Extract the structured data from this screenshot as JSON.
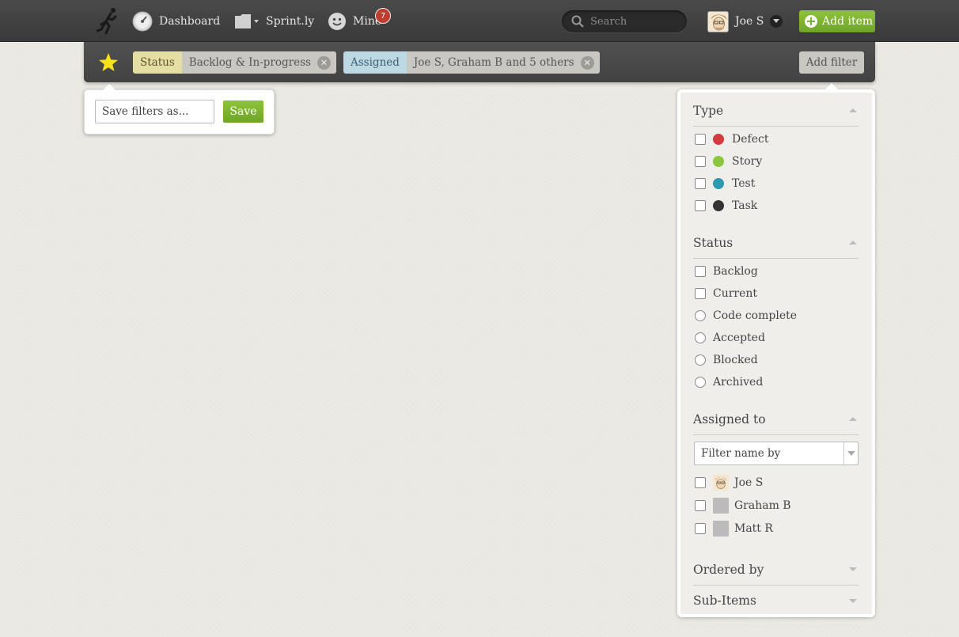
{
  "topbar": {
    "nav": {
      "dashboard": "Dashboard",
      "project": "Sprint.ly",
      "mine": "Mine",
      "mine_count": "7"
    },
    "search_placeholder": "Search",
    "user_name": "Joe S",
    "add_item": "Add item",
    "colors": {
      "bar": "#3f3f3f",
      "accent_green": "#7db433",
      "badge_red": "#c23b2f"
    }
  },
  "filters": {
    "status_label": "Status",
    "status_value": "Backlog & In-progress",
    "assigned_label": "Assigned",
    "assigned_value": "Joe S, Graham B and 5 others",
    "add_filter": "Add filter",
    "star_icon": "star-icon"
  },
  "save_popover": {
    "placeholder": "Save filters as...",
    "save_label": "Save"
  },
  "panel": {
    "type": {
      "title": "Type",
      "items": [
        {
          "label": "Defect",
          "color": "#d23b3f"
        },
        {
          "label": "Story",
          "color": "#8cc63e"
        },
        {
          "label": "Test",
          "color": "#2e9ab0"
        },
        {
          "label": "Task",
          "color": "#333333"
        }
      ]
    },
    "status": {
      "title": "Status",
      "items": [
        {
          "label": "Backlog",
          "control": "checkbox"
        },
        {
          "label": "Current",
          "control": "checkbox"
        },
        {
          "label": "Code complete",
          "control": "radio"
        },
        {
          "label": "Accepted",
          "control": "radio"
        },
        {
          "label": "Blocked",
          "control": "radio"
        },
        {
          "label": "Archived",
          "control": "radio"
        }
      ]
    },
    "assigned": {
      "title": "Assigned to",
      "filter_placeholder": "Filter name by",
      "items": [
        {
          "label": "Joe S"
        },
        {
          "label": "Graham B"
        },
        {
          "label": "Matt R"
        }
      ]
    },
    "ordered_by": {
      "title": "Ordered by"
    },
    "sub_items": {
      "title": "Sub-Items"
    }
  }
}
